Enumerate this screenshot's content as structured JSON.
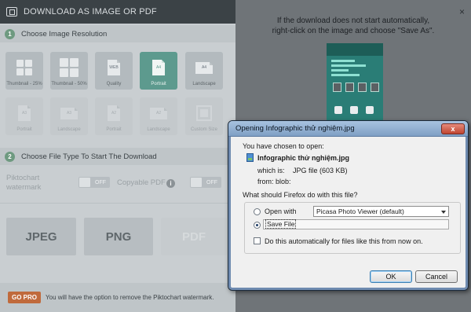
{
  "header": {
    "title": "DOWNLOAD AS IMAGE OR PDF"
  },
  "step1": {
    "number": "1",
    "title": "Choose Image Resolution"
  },
  "resolution_tiles": [
    {
      "label": "Thumbnail - 25%",
      "icon": "grid-small-icon"
    },
    {
      "label": "Thumbnail - 50%",
      "icon": "grid-large-icon"
    },
    {
      "label": "Quality",
      "badge": "WEB",
      "icon": "document-icon"
    },
    {
      "label": "Portrait",
      "badge": "A4",
      "icon": "document-icon",
      "selected": true
    },
    {
      "label": "Landscape",
      "badge": "A4",
      "icon": "document-landscape-icon"
    },
    {
      "label": "Portrait",
      "badge": "A3",
      "icon": "document-icon",
      "disabled": true
    },
    {
      "label": "Landscape",
      "badge": "A3",
      "icon": "document-landscape-icon",
      "disabled": true
    },
    {
      "label": "Portrait",
      "badge": "A2",
      "icon": "document-icon",
      "disabled": true
    },
    {
      "label": "Landscape",
      "badge": "A2",
      "icon": "document-landscape-icon",
      "disabled": true
    },
    {
      "label": "Custom Size",
      "icon": "frame-icon",
      "disabled": true
    }
  ],
  "step2": {
    "number": "2",
    "title": "Choose File Type To Start The Download"
  },
  "options": {
    "watermark_label_1": "Piktochart",
    "watermark_label_2": "watermark",
    "watermark_toggle": "OFF",
    "copyable_label": "Copyable PDF",
    "copyable_toggle": "OFF",
    "info": "i"
  },
  "formats": [
    "JPEG",
    "PNG",
    "PDF"
  ],
  "footer": {
    "gopro": "GO PRO",
    "text": "You will have the option to remove the Piktochart watermark."
  },
  "right": {
    "info_line1": "If the download does not start automatically,",
    "info_line2": "right-click on the image and choose \"Save As\".",
    "close": "×"
  },
  "dialog": {
    "title": "Opening Infographic thử nghiệm.jpg",
    "close": "x",
    "chosen": "You have chosen to open:",
    "filename": "Infographic thử nghiệm.jpg",
    "which_is_label": "which is:",
    "which_is_value": "JPG file (603 KB)",
    "from_label": "from:",
    "from_value": "blob:",
    "question": "What should Firefox do with this file?",
    "open_with_label": "Open with",
    "open_with_value": "Picasa Photo Viewer (default)",
    "save_file_label": "Save File",
    "auto_label": "Do this automatically for files like this from now on.",
    "ok": "OK",
    "cancel": "Cancel",
    "selected_action": "Save File"
  }
}
